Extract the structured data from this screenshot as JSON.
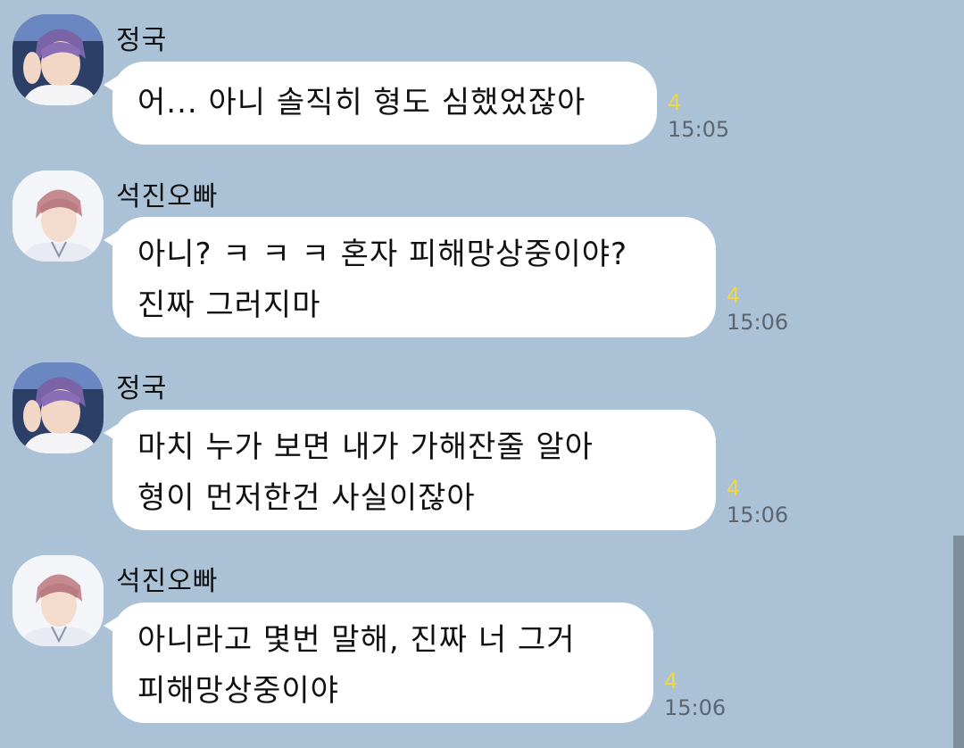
{
  "chat": {
    "background_color": "#abc1d5",
    "unread_color": "#f1d73c",
    "messages": [
      {
        "sender": "정국",
        "avatar_icon": "jungkook-avatar-icon",
        "lines": [
          "어... 아니 솔직히 형도 심했었잖아"
        ],
        "unread": "4",
        "time": "15:05"
      },
      {
        "sender": "석진오빠",
        "avatar_icon": "seokjin-avatar-icon",
        "lines": [
          "아니? ㅋ ㅋ ㅋ 혼자 피해망상중이야?",
          "진짜 그러지마"
        ],
        "unread": "4",
        "time": "15:06"
      },
      {
        "sender": "정국",
        "avatar_icon": "jungkook-avatar-icon",
        "lines": [
          "마치 누가 보면 내가 가해잔줄 알아",
          "형이 먼저한건 사실이잖아"
        ],
        "unread": "4",
        "time": "15:06"
      },
      {
        "sender": "석진오빠",
        "avatar_icon": "seokjin-avatar-icon",
        "lines": [
          "아니라고 몇번 말해, 진짜 너 그거",
          "피해망상중이야"
        ],
        "unread": "4",
        "time": "15:06"
      }
    ]
  }
}
